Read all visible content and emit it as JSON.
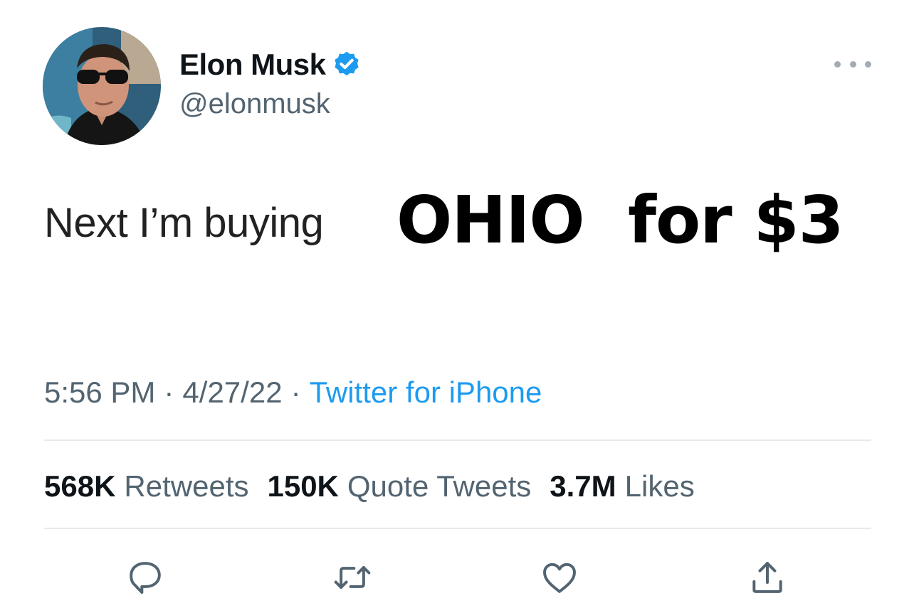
{
  "tweet": {
    "author": {
      "display_name": "Elon Musk",
      "handle": "@elonmusk",
      "verified": true
    },
    "text_regular": "Next I’m buying",
    "text_bold_1": "OHIO",
    "text_bold_2": "for $3",
    "meta": {
      "time": "5:56 PM",
      "separator": "·",
      "date": "4/27/22",
      "source": "Twitter for iPhone"
    },
    "stats": {
      "retweets_count": "568K",
      "retweets_label": "Retweets",
      "quotes_count": "150K",
      "quotes_label": "Quote Tweets",
      "likes_count": "3.7M",
      "likes_label": "Likes"
    },
    "actions": [
      "reply-icon",
      "retweet-icon",
      "like-icon",
      "share-icon"
    ]
  },
  "colors": {
    "accent": "#1d9bf0",
    "secondary_text": "#536471",
    "divider": "#e7eaec"
  }
}
